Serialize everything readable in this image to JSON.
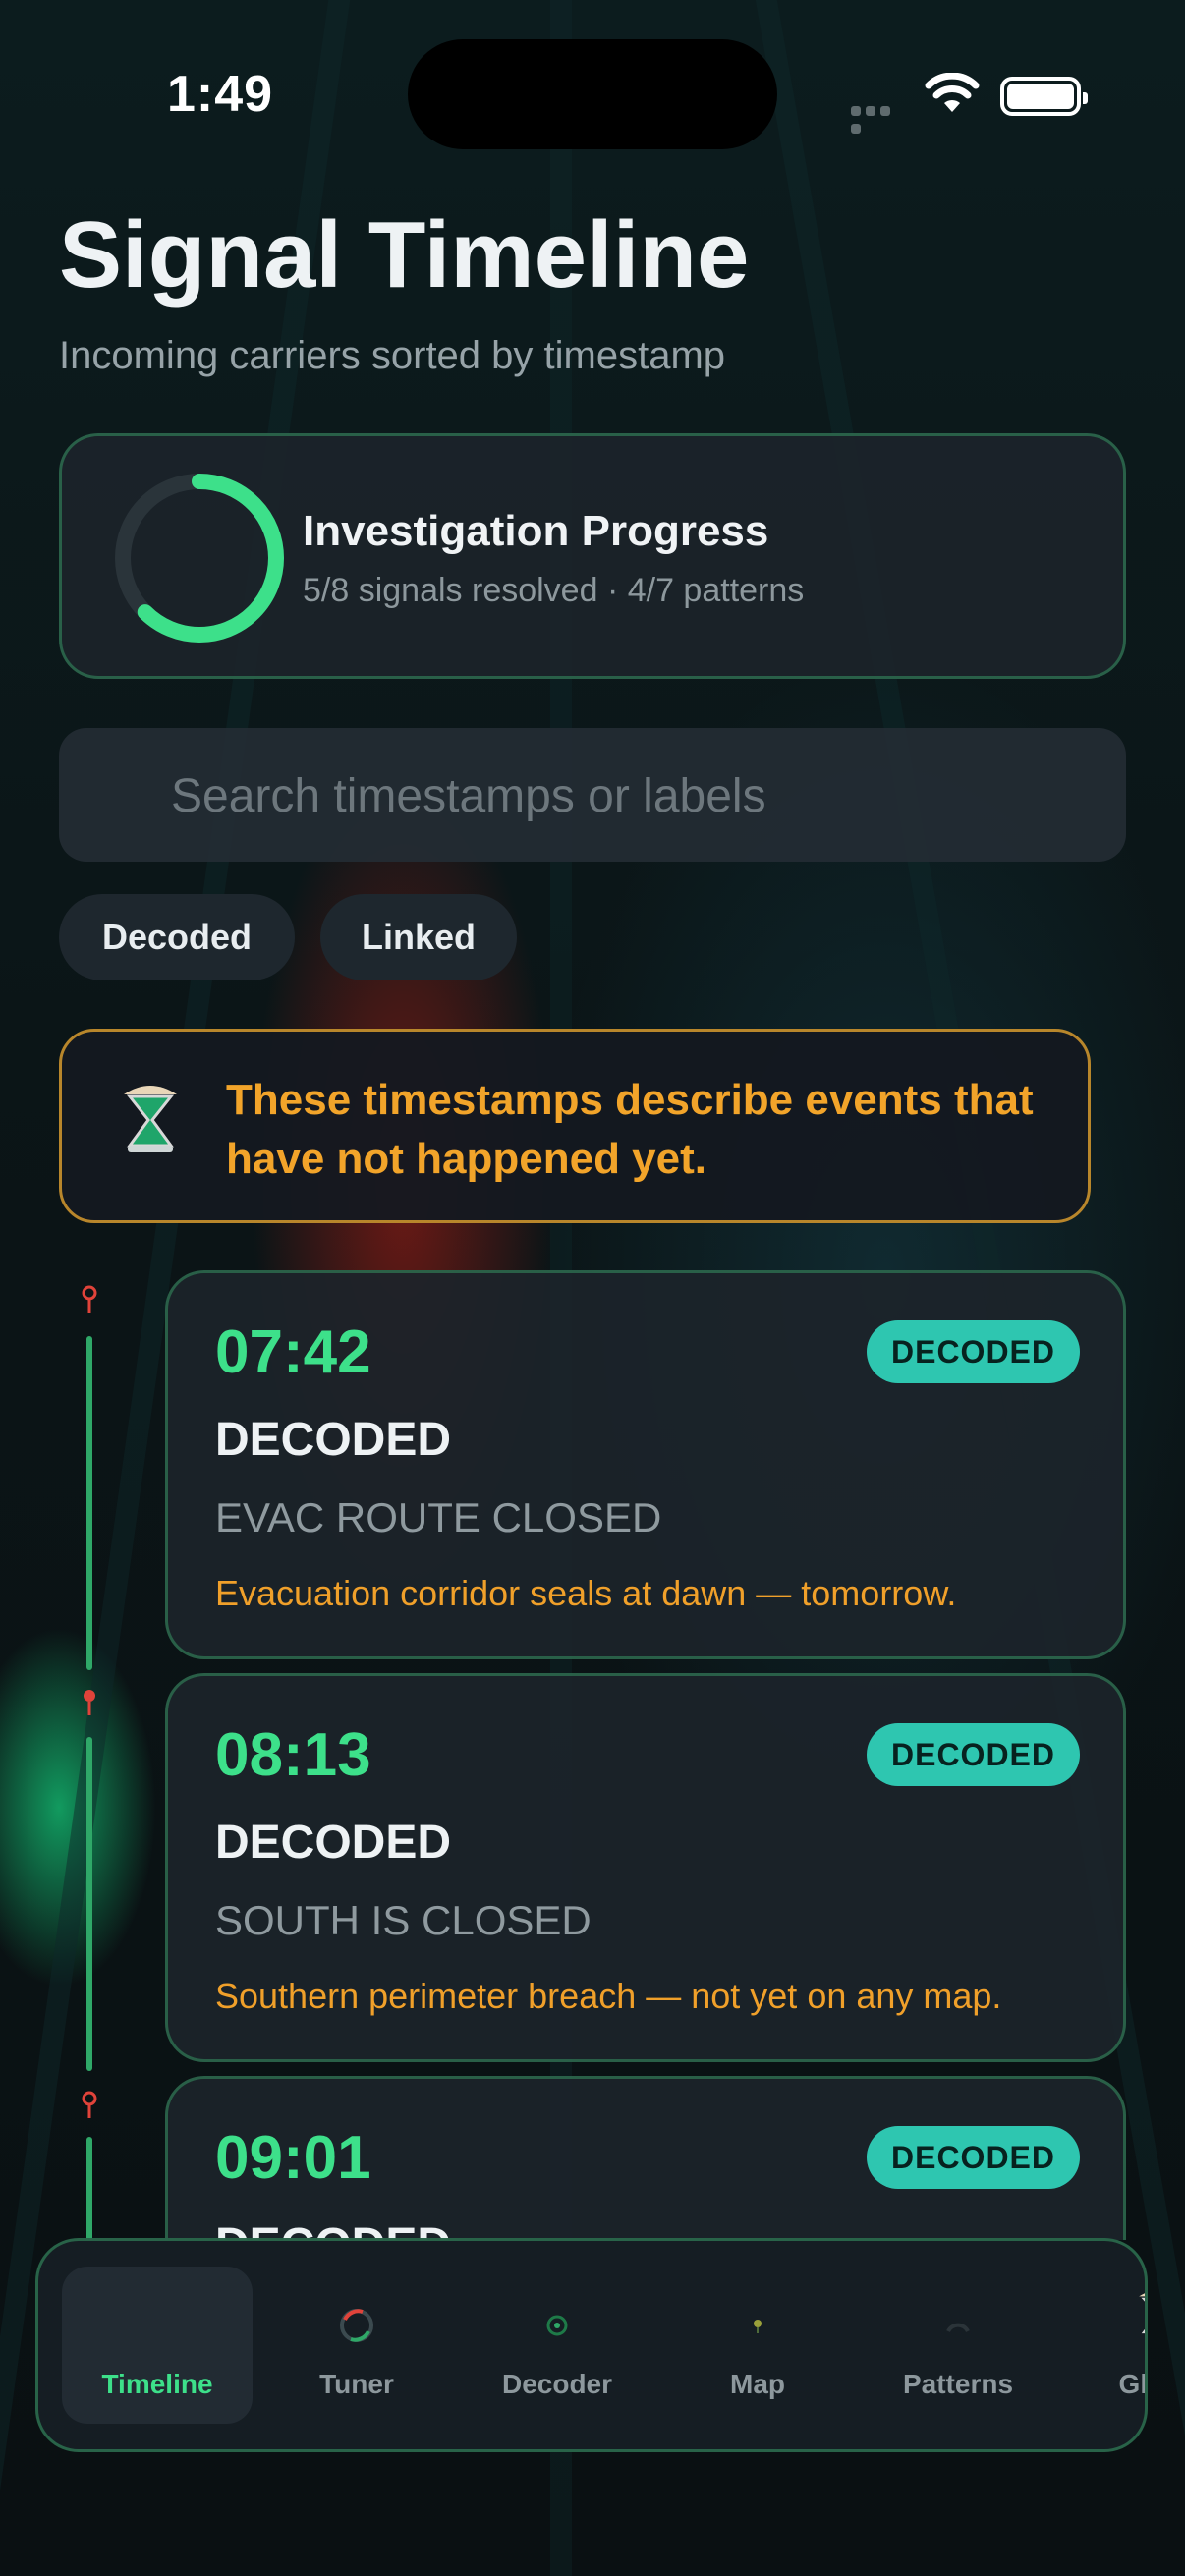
{
  "status_bar": {
    "time": "1:49"
  },
  "header": {
    "title": "Signal Timeline",
    "subtitle": "Incoming carriers sorted by timestamp"
  },
  "progress_card": {
    "title": "Investigation Progress",
    "detail": "5/8 signals resolved · 4/7 patterns",
    "fraction": 0.625,
    "accent": "#3de08a"
  },
  "search": {
    "placeholder": "Search timestamps or labels"
  },
  "filters": {
    "decoded": "Decoded",
    "linked": "Linked"
  },
  "warning": {
    "icon": "hourglass-icon",
    "text": "These timestamps describe events that have not happened yet.",
    "color": "#f2a42a"
  },
  "signals": [
    {
      "time": "07:42",
      "badge": "DECODED",
      "status": "DECODED",
      "label": "EVAC ROUTE CLOSED",
      "note": "Evacuation corridor seals at dawn — tomorrow."
    },
    {
      "time": "08:13",
      "badge": "DECODED",
      "status": "DECODED",
      "label": "SOUTH IS CLOSED",
      "note": "Southern perimeter breach — not yet on any map."
    },
    {
      "time": "09:01",
      "badge": "DECODED",
      "status": "DECODED",
      "label": "",
      "note": ""
    }
  ],
  "tabs": [
    {
      "label": "Timeline",
      "icon": "timeline-icon",
      "active": true
    },
    {
      "label": "Tuner",
      "icon": "tuner-dial-icon",
      "active": false
    },
    {
      "label": "Decoder",
      "icon": "decoder-icon",
      "active": false
    },
    {
      "label": "Map",
      "icon": "map-pin-icon",
      "active": false
    },
    {
      "label": "Patterns",
      "icon": "patterns-icon",
      "active": false
    },
    {
      "label": "Ghost",
      "icon": "hourglass-icon",
      "active": false
    }
  ]
}
